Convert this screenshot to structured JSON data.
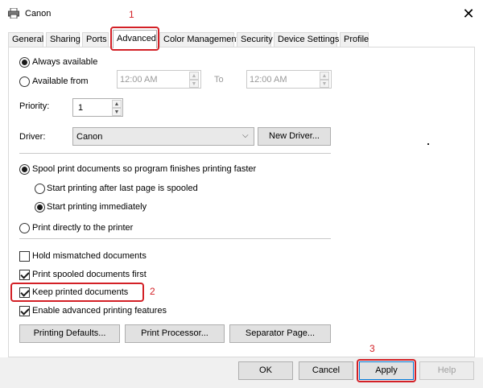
{
  "window": {
    "title": "Canon"
  },
  "tabs": [
    {
      "label": "General"
    },
    {
      "label": "Sharing"
    },
    {
      "label": "Ports"
    },
    {
      "label": "Advanced"
    },
    {
      "label": "Color Management"
    },
    {
      "label": "Security"
    },
    {
      "label": "Device Settings"
    },
    {
      "label": "Profile"
    }
  ],
  "availability": {
    "always_label": "Always available",
    "from_label": "Available from",
    "from_time": "12:00 AM",
    "to_label": "To",
    "to_time": "12:00 AM"
  },
  "priority": {
    "label": "Priority:",
    "value": "1"
  },
  "driver": {
    "label": "Driver:",
    "value": "Canon",
    "new_button": "New Driver..."
  },
  "spool": {
    "spool_label": "Spool print documents so program finishes printing faster",
    "after_last_label": "Start printing after last page is spooled",
    "immediately_label": "Start printing immediately",
    "direct_label": "Print directly to the printer"
  },
  "options": {
    "hold_mismatched": "Hold mismatched documents",
    "spooled_first": "Print spooled documents first",
    "keep_printed": "Keep printed documents",
    "advanced_features": "Enable advanced printing features"
  },
  "buttons": {
    "printing_defaults": "Printing Defaults...",
    "print_processor": "Print Processor...",
    "separator_page": "Separator Page...",
    "ok": "OK",
    "cancel": "Cancel",
    "apply": "Apply",
    "help": "Help"
  },
  "annotations": {
    "one": "1",
    "two": "2",
    "three": "3"
  },
  "colors": {
    "annotation": "#d32026",
    "dialog_bg": "#f0f0f0"
  }
}
